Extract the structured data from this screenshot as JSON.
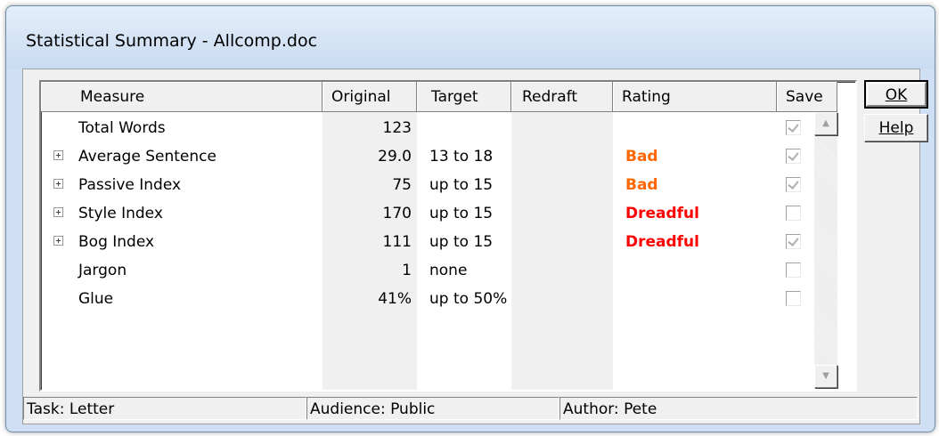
{
  "window": {
    "title": "Statistical Summary - Allcomp.doc"
  },
  "columns": {
    "measure": "Measure",
    "original": "Original",
    "target": "Target",
    "redraft": "Redraft",
    "rating": "Rating",
    "save": "Save"
  },
  "rows": [
    {
      "measure": "Total Words",
      "original": "123",
      "target": "",
      "redraft": "",
      "rating": "",
      "rating_level": "",
      "expandable": false,
      "save": true
    },
    {
      "measure": "Average Sentence",
      "original": "29.0",
      "target": "13 to 18",
      "redraft": "",
      "rating": "Bad",
      "rating_level": "bad",
      "expandable": true,
      "save": true
    },
    {
      "measure": "Passive Index",
      "original": "75",
      "target": "up to 15",
      "redraft": "",
      "rating": "Bad",
      "rating_level": "bad",
      "expandable": true,
      "save": true
    },
    {
      "measure": "Style Index",
      "original": "170",
      "target": "up to 15",
      "redraft": "",
      "rating": "Dreadful",
      "rating_level": "dreadful",
      "expandable": true,
      "save": false
    },
    {
      "measure": "Bog Index",
      "original": "111",
      "target": "up to 15",
      "redraft": "",
      "rating": "Dreadful",
      "rating_level": "dreadful",
      "expandable": true,
      "save": true
    },
    {
      "measure": "Jargon",
      "original": "1",
      "target": "none",
      "redraft": "",
      "rating": "",
      "rating_level": "",
      "expandable": false,
      "save": false
    },
    {
      "measure": "Glue",
      "original": "41%",
      "target": "up to 50%",
      "redraft": "",
      "rating": "",
      "rating_level": "",
      "expandable": false,
      "save": false
    }
  ],
  "buttons": {
    "ok": "OK",
    "help": "Help"
  },
  "status": {
    "task": "Task: Letter",
    "audience": "Audience: Public",
    "author": "Author: Pete"
  },
  "colors": {
    "bad": "#ff6600",
    "dreadful": "#ff0000"
  }
}
